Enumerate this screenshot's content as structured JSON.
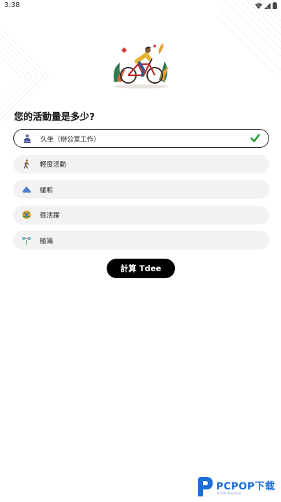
{
  "status_bar": {
    "time": "3:38",
    "icons": [
      "wifi-icon",
      "signal-icon",
      "battery-icon"
    ]
  },
  "illustration": "cyclist-icon",
  "question": "您的活動量是多少?",
  "options": [
    {
      "label": "久坐（辦公室工作）",
      "icon": "sitting-person-icon",
      "selected": true
    },
    {
      "label": "輕度活動",
      "icon": "walking-person-icon",
      "selected": false
    },
    {
      "label": "緩和",
      "icon": "running-shoe-icon",
      "selected": false
    },
    {
      "label": "很活躍",
      "icon": "active-globe-icon",
      "selected": false
    },
    {
      "label": "極端",
      "icon": "dumbbell-icon",
      "selected": false
    }
  ],
  "calculate_button": "計算 Tdee",
  "watermark": {
    "brand": "PCPOP下载",
    "sub": "PCPOP Download"
  },
  "colors": {
    "selected_border": "#222222",
    "check": "#1a9a2a",
    "button": "#000000",
    "option_bg": "#f2f2f2"
  }
}
